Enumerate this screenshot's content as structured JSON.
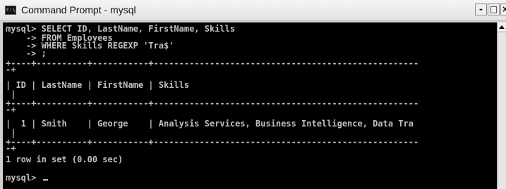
{
  "window": {
    "title": "Command Prompt - mysql",
    "min_label": "-",
    "max_label": "□",
    "close_label": "×"
  },
  "console": {
    "lines": [
      "mysql> SELECT ID, LastName, FirstName, Skills",
      "    -> FROM Employees",
      "    -> WHERE Skills REGEXP 'Tra$'",
      "    -> ;",
      "+----+----------+-----------+----------------------------------------------------",
      "-+",
      "| ID | LastName | FirstName | Skills",
      " |",
      "+----+----------+-----------+----------------------------------------------------",
      "-+",
      "|  1 | Smith    | George    | Analysis Services, Business Intelligence, Data Tra",
      " |",
      "+----+----------+-----------+----------------------------------------------------",
      "-+",
      "1 row in set (0.00 sec)",
      "",
      "mysql> "
    ]
  },
  "colors": {
    "console_bg": "#000000",
    "console_fg": "#c0c0c0",
    "titlebar": "#eaeaea"
  },
  "icons": {
    "app": "cmd-icon",
    "scroll_up": "arrow-up-icon"
  }
}
